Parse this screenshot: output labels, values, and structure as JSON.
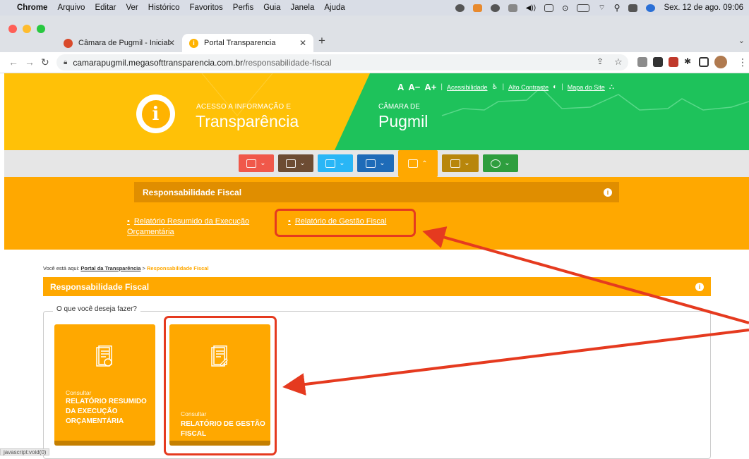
{
  "menubar": {
    "app": "Chrome",
    "items": [
      "Arquivo",
      "Editar",
      "Ver",
      "Histórico",
      "Favoritos",
      "Perfis",
      "Guia",
      "Janela",
      "Ajuda"
    ],
    "datetime": "Sex. 12 de ago.  09:06"
  },
  "tabs": [
    {
      "title": "Câmara de Pugmil - Inicial",
      "active": false
    },
    {
      "title": "Portal Transparencia",
      "active": true
    }
  ],
  "toolbar": {
    "url_host": "camarapugmil.megasofttransparencia.com.br",
    "url_path": "/responsabilidade-fiscal"
  },
  "header": {
    "tagline": "ACESSO A INFORMAÇÃO E",
    "title": "Transparência",
    "entity_label": "CÂMARA DE",
    "entity_name": "Pugmil",
    "font_small": "A",
    "font_decrease": "A−",
    "font_increase": "A+",
    "accessibility": "Acessibilidade",
    "high_contrast": "Alto Contraste",
    "sitemap": "Mapa do Site"
  },
  "menu_colors": [
    "#f0584a",
    "#6d4c33",
    "#29b6f6",
    "#1e6bb8",
    "#ffa800",
    "#b8860b",
    "#2e9e3e"
  ],
  "submenu": {
    "title": "Responsabilidade Fiscal",
    "links": [
      "Relatório Resumido da Execução Orçamentária",
      "Relatório de Gestão Fiscal"
    ]
  },
  "breadcrumb": {
    "prefix": "Você está aqui:",
    "home": "Portal da Transparência",
    "sep": ">",
    "current": "Responsabilidade Fiscal"
  },
  "section": {
    "title": "Responsabilidade Fiscal",
    "legend": "O que você deseja fazer?"
  },
  "cards": [
    {
      "action": "Consultar",
      "title": "RELATÓRIO RESUMIDO DA EXECUÇÃO ORÇAMENTÁRIA"
    },
    {
      "action": "Consultar",
      "title": "RELATÓRIO DE GESTÃO FISCAL"
    }
  ],
  "statusbar": "javascript:void(0)",
  "annotation_color": "#e53a1f"
}
